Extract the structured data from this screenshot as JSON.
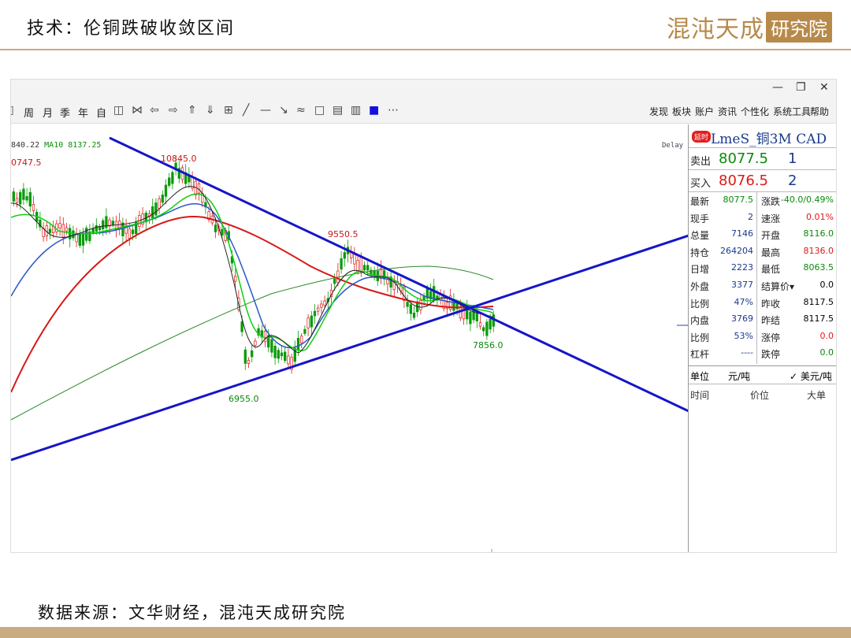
{
  "slide": {
    "title": "技术：伦铜跌破收敛区间",
    "brand_a": "混沌天成",
    "brand_b": "研究院",
    "source": "数据来源：文华财经，混沌天成研究院"
  },
  "window": {
    "minimize": "—",
    "restore": "❐",
    "close": "✕"
  },
  "toolbar": {
    "periods": [
      "周",
      "月",
      "季",
      "年",
      "自"
    ],
    "tools_icons": [
      "◫",
      "⋈",
      "⇦",
      "⇨",
      "⇑",
      "⇓",
      "⊞",
      "╱",
      "—",
      "↘",
      "≈",
      "□",
      "▤",
      "▥",
      "■",
      "⋯"
    ],
    "right_menu": [
      "发现",
      "板块",
      "账户",
      "资讯",
      "个性化",
      "系统工具",
      "帮助"
    ]
  },
  "chart": {
    "ma_legend_prefix": "840.22",
    "ma_legend_ma10": "MA10 8137.25",
    "delay_label": "Delay",
    "annotations": {
      "left_high": "0747.5",
      "high": "10845.0",
      "low": "6955.0",
      "mid_high": "9550.5",
      "recent_low": "7856.0"
    }
  },
  "panel": {
    "tag": "延时",
    "name": "LmeS_铜3M CAD",
    "sell_label": "卖出",
    "sell_price": "8077.5",
    "sell_vol": "1",
    "buy_label": "买入",
    "buy_price": "8076.5",
    "buy_vol": "2",
    "rows": [
      {
        "l1": "最新",
        "v1": "8077.5",
        "c1": "green",
        "l2": "涨跌",
        "v2": "-40.0/0.49%",
        "c2": "green"
      },
      {
        "l1": "现手",
        "v1": "2",
        "c1": "blue",
        "l2": "速涨",
        "v2": "0.01%",
        "c2": "red"
      },
      {
        "l1": "总量",
        "v1": "7146",
        "c1": "blue",
        "l2": "开盘",
        "v2": "8116.0",
        "c2": "green"
      },
      {
        "l1": "持仓",
        "v1": "264204",
        "c1": "blue",
        "l2": "最高",
        "v2": "8136.0",
        "c2": "red"
      },
      {
        "l1": "日增",
        "v1": "2223",
        "c1": "blue",
        "l2": "最低",
        "v2": "8063.5",
        "c2": "green"
      },
      {
        "l1": "外盘",
        "v1": "3377",
        "c1": "blue",
        "l2": "结算价▾",
        "v2": "0.0",
        "c2": "black"
      },
      {
        "l1": "比例",
        "v1": "47%",
        "c1": "blue",
        "l2": "昨收",
        "v2": "8117.5",
        "c2": "black"
      },
      {
        "l1": "内盘",
        "v1": "3769",
        "c1": "blue",
        "l2": "昨结",
        "v2": "8117.5",
        "c2": "black"
      },
      {
        "l1": "比例",
        "v1": "53%",
        "c1": "blue",
        "l2": "涨停",
        "v2": "0.0",
        "c2": "red"
      },
      {
        "l1": "杠杆",
        "v1": "----",
        "c1": "blue",
        "l2": "跌停",
        "v2": "0.0",
        "c2": "green"
      }
    ],
    "unit_label": "单位",
    "unit_cny": "元/吨",
    "unit_usd": "✓ 美元/吨",
    "col_time": "时间",
    "col_price": "价位",
    "col_big": "大单"
  }
}
